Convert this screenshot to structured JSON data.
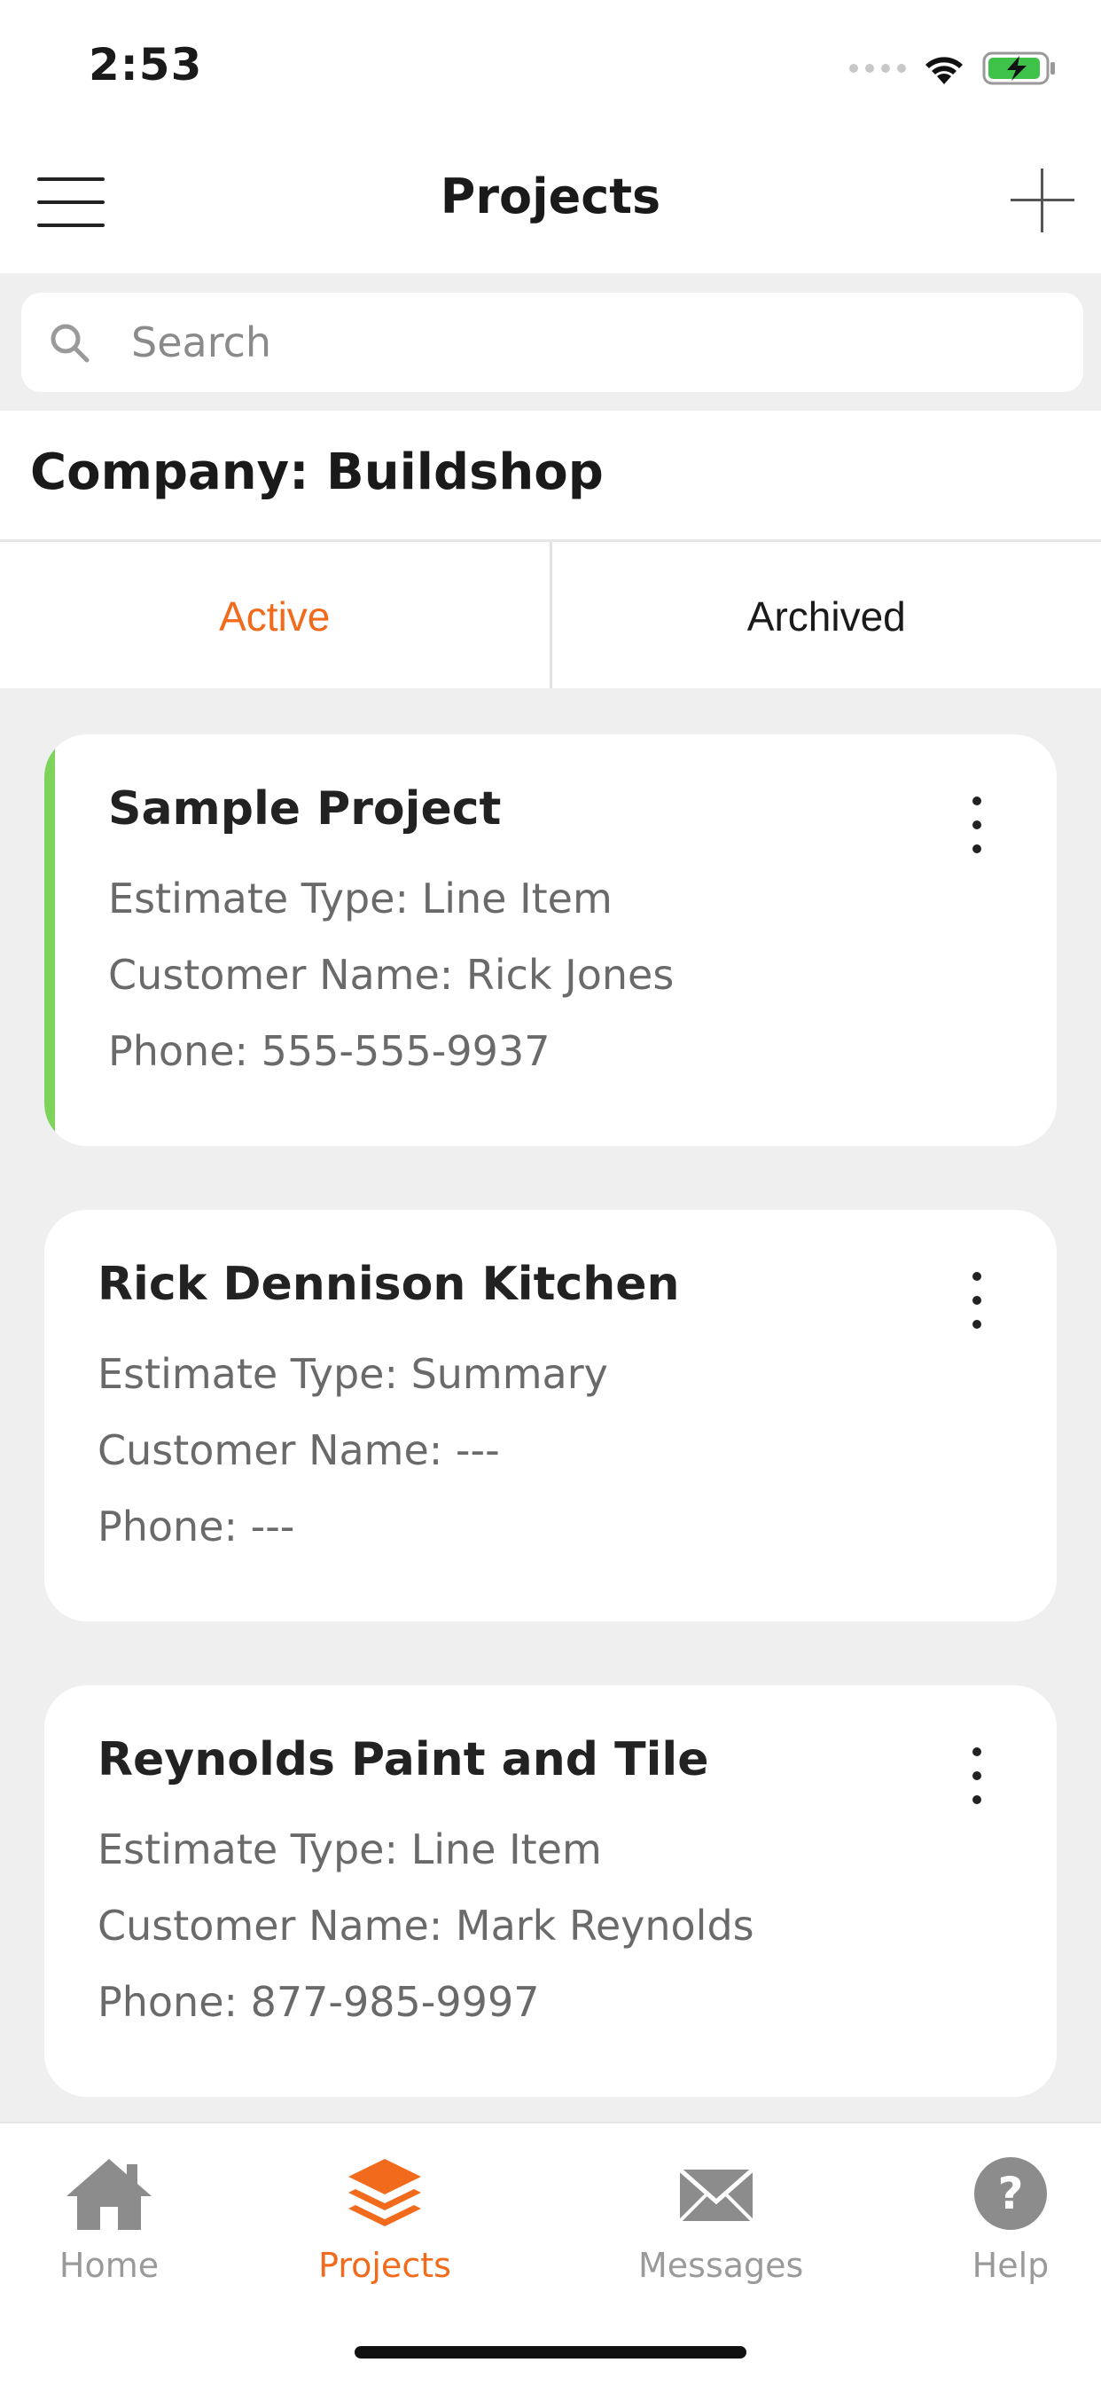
{
  "status_bar": {
    "time": "2:53"
  },
  "nav": {
    "title": "Projects"
  },
  "search": {
    "placeholder": "Search"
  },
  "company": {
    "label": "Company: Buildshop"
  },
  "tabs": [
    {
      "label": "Active",
      "selected": true
    },
    {
      "label": "Archived",
      "selected": false
    }
  ],
  "projects": [
    {
      "name": "Sample Project",
      "estimate": "Estimate Type: Line Item",
      "customer": "Customer Name: Rick Jones",
      "phone": "Phone: 555-555-9937"
    },
    {
      "name": "Rick Dennison Kitchen",
      "estimate": "Estimate Type: Summary",
      "customer": "Customer Name: ---",
      "phone": "Phone: ---"
    },
    {
      "name": "Reynolds Paint and Tile",
      "estimate": "Estimate Type: Line Item",
      "customer": "Customer Name: Mark Reynolds",
      "phone": "Phone: 877-985-9997"
    }
  ],
  "tab_bar": [
    {
      "label": "Home",
      "icon": "home-icon"
    },
    {
      "label": "Projects",
      "icon": "layers-icon"
    },
    {
      "label": "Messages",
      "icon": "envelope-icon"
    },
    {
      "label": "Help",
      "icon": "help-icon"
    }
  ],
  "colors": {
    "accent": "#f26b1d",
    "active_project": "#7ed35a",
    "inactive_icon": "#8c8c8c"
  }
}
